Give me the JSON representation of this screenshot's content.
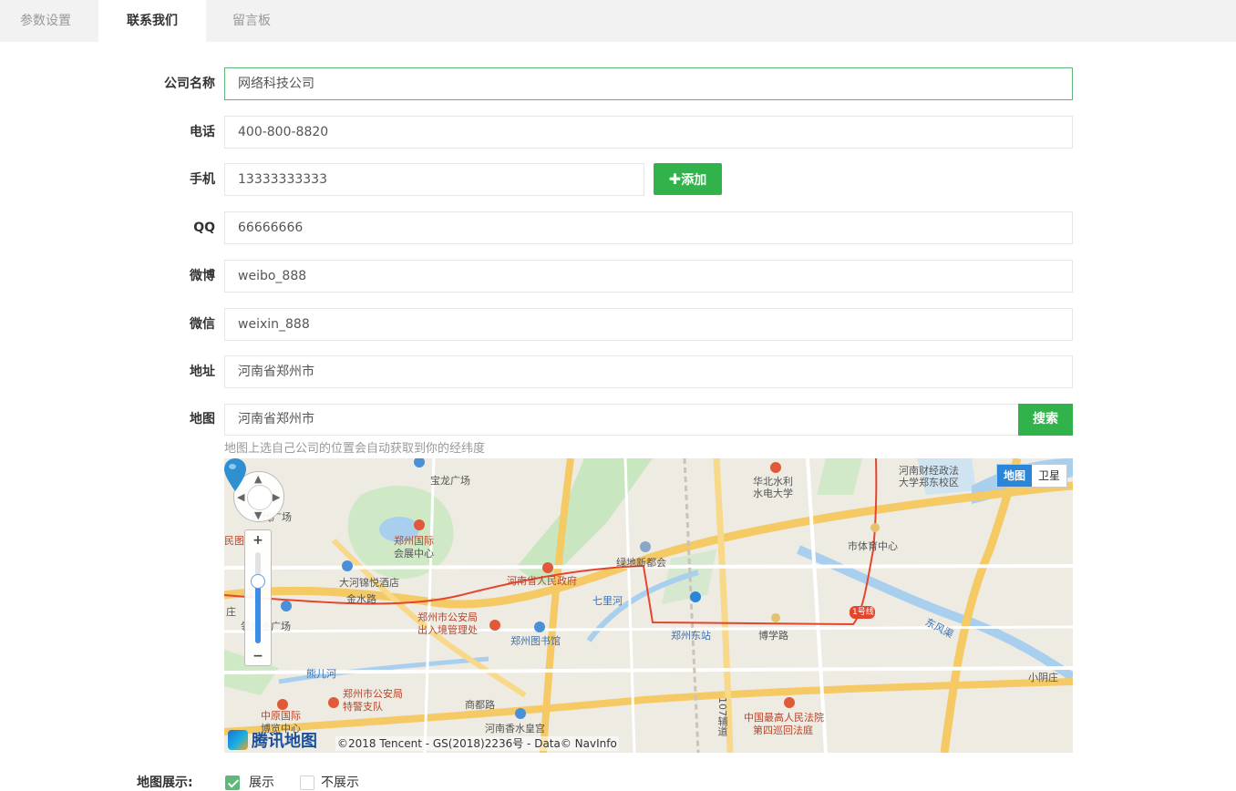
{
  "tabs": [
    {
      "label": "参数设置",
      "active": false
    },
    {
      "label": "联系我们",
      "active": true
    },
    {
      "label": "留言板",
      "active": false
    }
  ],
  "form": {
    "company_label": "公司名称",
    "company_value": "网络科技公司",
    "phone_label": "电话",
    "phone_value": "400-800-8820",
    "mobile_label": "手机",
    "mobile_value": "13333333333",
    "add_button": "添加",
    "qq_label": "QQ",
    "qq_value": "66666666",
    "weibo_label": "微博",
    "weibo_value": "weibo_888",
    "weixin_label": "微信",
    "weixin_value": "weixin_888",
    "address_label": "地址",
    "address_value": "河南省郑州市",
    "map_label": "地图",
    "map_value": "河南省郑州市",
    "search_button": "搜索",
    "map_hint": "地图上选自己公司的位置会自动获取到你的经纬度"
  },
  "map": {
    "type_map": "地图",
    "type_satellite": "卫星",
    "brand": "腾讯地图",
    "copyright": "©2018 Tencent - GS(2018)2236号 - Data© NavInfo",
    "labels": {
      "l1": "宝龙广场",
      "l2": "华北水利",
      "l3": "水电大学",
      "l4": "河南财经政法",
      "l5": "大学郑东校区",
      "l6": "时代广场",
      "l7": "郑州国际",
      "l8": "会展中心",
      "l9": "民图",
      "l10": "绿地新都会",
      "l11": "市体育中心",
      "l12": "大河锦悦酒店",
      "l13": "河南省人民政府",
      "l14": "金水路",
      "l15": "七里河",
      "l16": "郑州东站",
      "l17": "博学路",
      "l18": "1号线",
      "l19": "东风渠",
      "l20": "庄",
      "l21": "领商业广场",
      "l22": "郑州市公安局",
      "l23": "出入境管理处",
      "l24": "郑州图书馆",
      "l25": "熊儿河",
      "l26": "小阴庄",
      "l27": "郑州市公安局",
      "l28": "特警支队",
      "l29": "中原国际",
      "l30": "博览中心",
      "l31": "商都路",
      "l32": "中国最高人民法院",
      "l33": "第四巡回法庭",
      "l34": "河南香水皇宫",
      "l35": "107辅道"
    }
  },
  "display": {
    "label": "地图展示:",
    "option_show": "展示",
    "option_hide": "不展示",
    "selected": "展示"
  },
  "colors": {
    "accent_green": "#31b24a",
    "focus_border": "#5FB878",
    "map_blue": "#2a86d8"
  }
}
